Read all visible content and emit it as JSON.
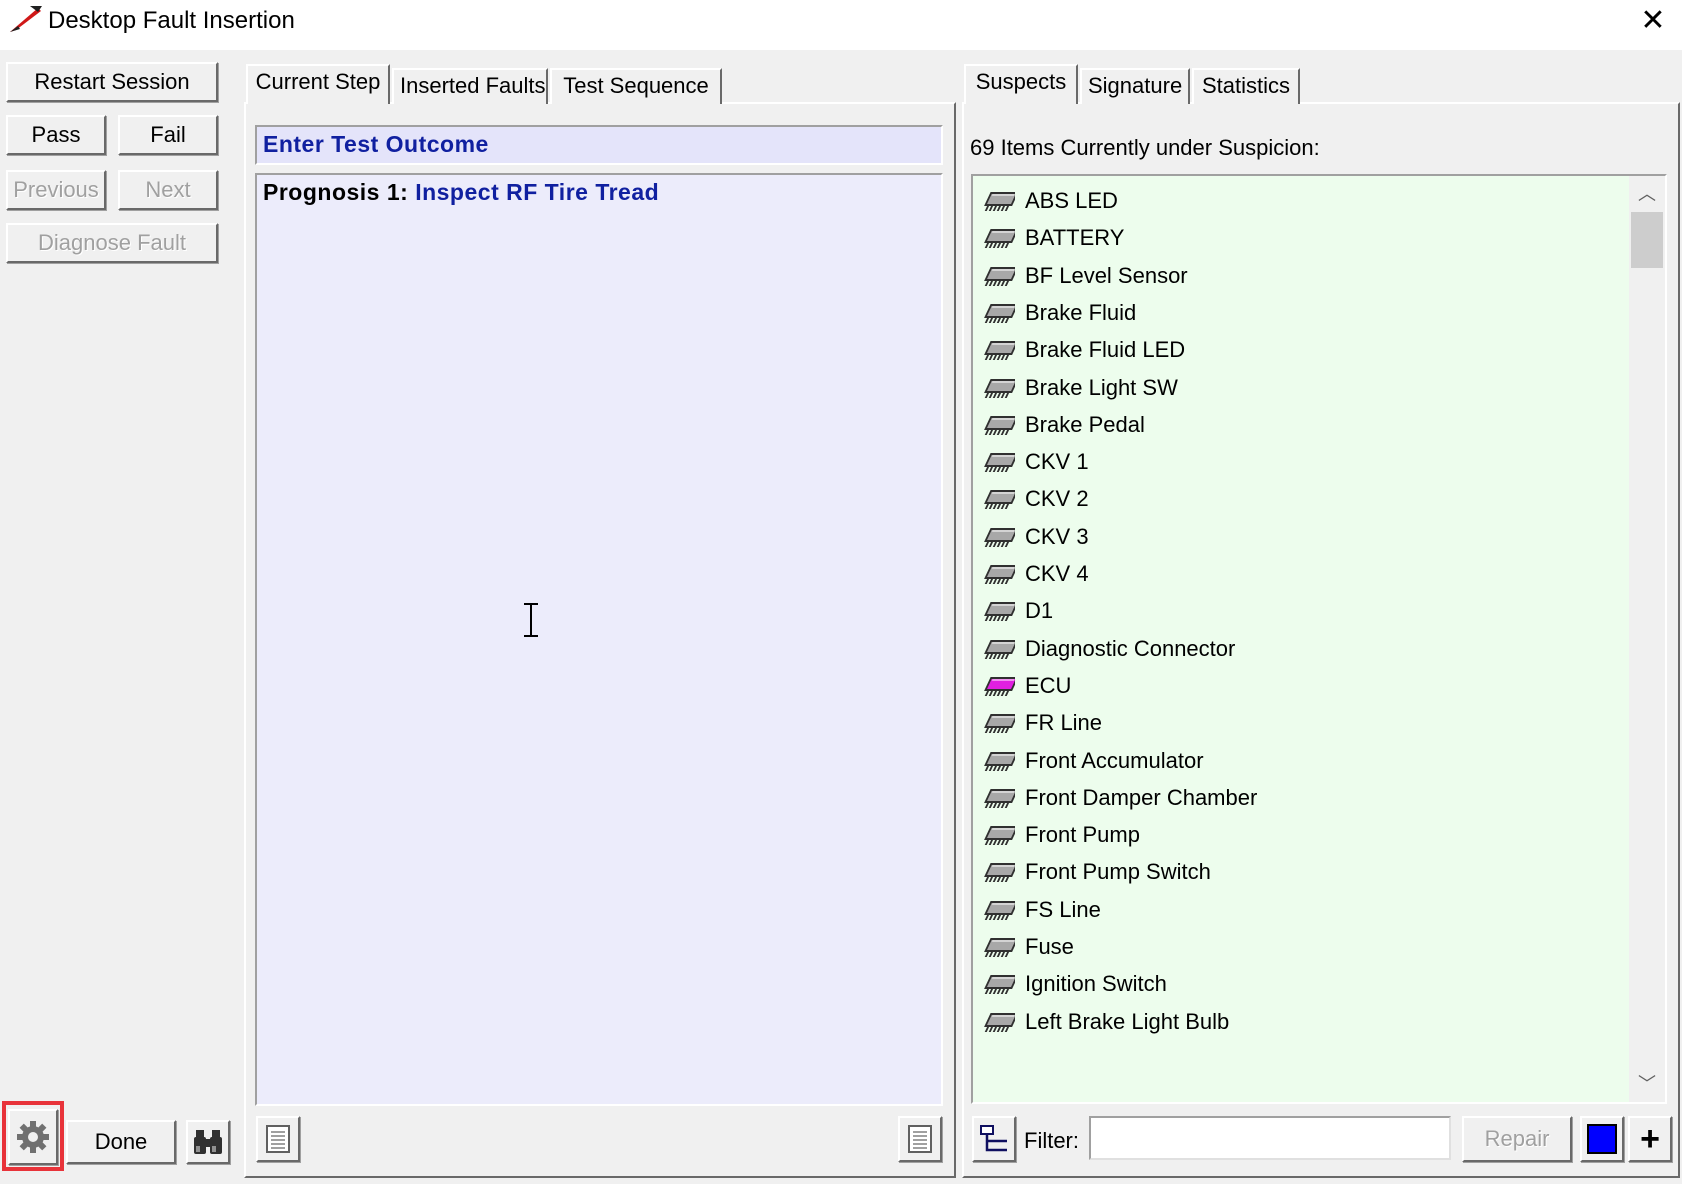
{
  "window": {
    "title": "Desktop Fault Insertion",
    "close_glyph": "✕"
  },
  "left_panel": {
    "restart": "Restart Session",
    "pass": "Pass",
    "fail": "Fail",
    "previous": "Previous",
    "next": "Next",
    "diagnose": "Diagnose Fault",
    "done": "Done"
  },
  "middle_panel": {
    "tabs": [
      "Current Step",
      "Inserted Faults",
      "Test Sequence"
    ],
    "active_tab": "Current Step",
    "outcome_heading": "Enter Test Outcome",
    "prognosis_label": "Prognosis 1:",
    "prognosis_value": "Inspect RF Tire Tread"
  },
  "right_panel": {
    "tabs": [
      "Suspects",
      "Signature",
      "Statistics"
    ],
    "active_tab": "Suspects",
    "summary": "69 Items Currently under Suspicion:",
    "items": [
      {
        "label": "ABS LED",
        "icon": "chip-gray"
      },
      {
        "label": "BATTERY",
        "icon": "chip-gray"
      },
      {
        "label": "BF Level Sensor",
        "icon": "chip-gray"
      },
      {
        "label": "Brake Fluid",
        "icon": "chip-gray"
      },
      {
        "label": "Brake Fluid LED",
        "icon": "chip-gray"
      },
      {
        "label": "Brake Light SW",
        "icon": "chip-gray"
      },
      {
        "label": "Brake Pedal",
        "icon": "chip-gray"
      },
      {
        "label": "CKV 1",
        "icon": "chip-gray"
      },
      {
        "label": "CKV 2",
        "icon": "chip-gray"
      },
      {
        "label": "CKV 3",
        "icon": "chip-gray"
      },
      {
        "label": "CKV 4",
        "icon": "chip-gray"
      },
      {
        "label": "D1",
        "icon": "chip-gray"
      },
      {
        "label": "Diagnostic Connector",
        "icon": "chip-gray"
      },
      {
        "label": "ECU",
        "icon": "chip-magenta"
      },
      {
        "label": "FR Line",
        "icon": "chip-gray"
      },
      {
        "label": "Front Accumulator",
        "icon": "chip-gray"
      },
      {
        "label": "Front Damper Chamber",
        "icon": "chip-gray"
      },
      {
        "label": "Front Pump",
        "icon": "chip-gray"
      },
      {
        "label": "Front Pump Switch",
        "icon": "chip-gray"
      },
      {
        "label": "FS Line",
        "icon": "chip-gray"
      },
      {
        "label": "Fuse",
        "icon": "chip-gray"
      },
      {
        "label": "Ignition Switch",
        "icon": "chip-gray"
      },
      {
        "label": "Left Brake Light Bulb",
        "icon": "chip-gray"
      }
    ],
    "filter_label": "Filter:",
    "filter_value": "",
    "repair": "Repair",
    "plus_glyph": "+"
  },
  "colors": {
    "outcome_text": "#1020a0",
    "outcome_bg": "#e4e4fa",
    "list_bg": "#edfded",
    "highlight": "#e8333a",
    "chip_magenta": "#e020e0",
    "color_swatch": "#0000ff"
  }
}
